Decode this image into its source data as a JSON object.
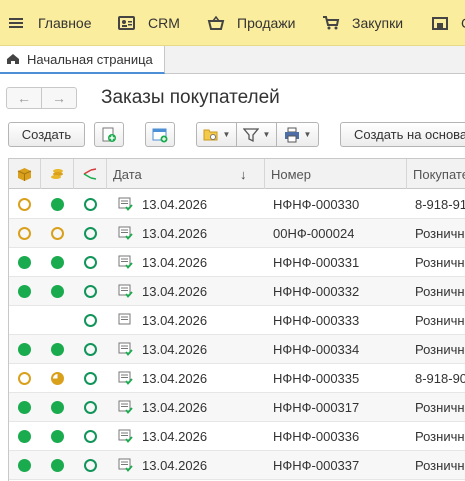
{
  "menu": [
    {
      "label": "Главное",
      "icon": "hamburger-icon"
    },
    {
      "label": "CRM",
      "icon": "contact-card-icon"
    },
    {
      "label": "Продажи",
      "icon": "basket-icon"
    },
    {
      "label": "Закупки",
      "icon": "cart-icon"
    },
    {
      "label": "С",
      "icon": "warehouse-icon"
    }
  ],
  "tab": {
    "label": "Начальная страница",
    "icon": "home-icon"
  },
  "form": {
    "title": "Заказы покупателей"
  },
  "toolbar": {
    "create_label": "Создать",
    "create_based_label": "Создать на основа"
  },
  "table": {
    "columns": {
      "date": "Дата",
      "sort_indicator": "↓",
      "number": "Номер",
      "customer": "Покупате"
    },
    "status_colors": {
      "green": "#1aab4e",
      "orange": "#d9a01c",
      "teal": "#11955a"
    },
    "rows": [
      {
        "s1": "orange-ring",
        "s2": "green",
        "s3": "green-ring",
        "date": "13.04.2026",
        "number": "НФНФ-000330",
        "customer": "8-918-91"
      },
      {
        "s1": "orange-ring",
        "s2": "orange-ring",
        "s3": "green-ring",
        "date": "13.04.2026",
        "number": "00НФ-000024",
        "customer": "Розничн"
      },
      {
        "s1": "green",
        "s2": "green",
        "s3": "green-ring",
        "date": "13.04.2026",
        "number": "НФНФ-000331",
        "customer": "Розничн"
      },
      {
        "s1": "green",
        "s2": "green",
        "s3": "green-ring",
        "date": "13.04.2026",
        "number": "НФНФ-000332",
        "customer": "Розничн"
      },
      {
        "s1": "none",
        "s2": "none",
        "s3": "green-ring",
        "date": "13.04.2026",
        "number": "НФНФ-000333",
        "customer": "Розничн"
      },
      {
        "s1": "green",
        "s2": "green",
        "s3": "green-ring",
        "date": "13.04.2026",
        "number": "НФНФ-000334",
        "customer": "Розничн"
      },
      {
        "s1": "orange-ring",
        "s2": "orange-partial",
        "s3": "green-ring",
        "date": "13.04.2026",
        "number": "НФНФ-000335",
        "customer": "8-918-90"
      },
      {
        "s1": "green",
        "s2": "green",
        "s3": "green-ring",
        "date": "13.04.2026",
        "number": "НФНФ-000317",
        "customer": "Розничн"
      },
      {
        "s1": "green",
        "s2": "green",
        "s3": "green-ring",
        "date": "13.04.2026",
        "number": "НФНФ-000336",
        "customer": "Розничн"
      },
      {
        "s1": "green",
        "s2": "green",
        "s3": "green-ring",
        "date": "13.04.2026",
        "number": "НФНФ-000337",
        "customer": "Розничн"
      }
    ]
  }
}
